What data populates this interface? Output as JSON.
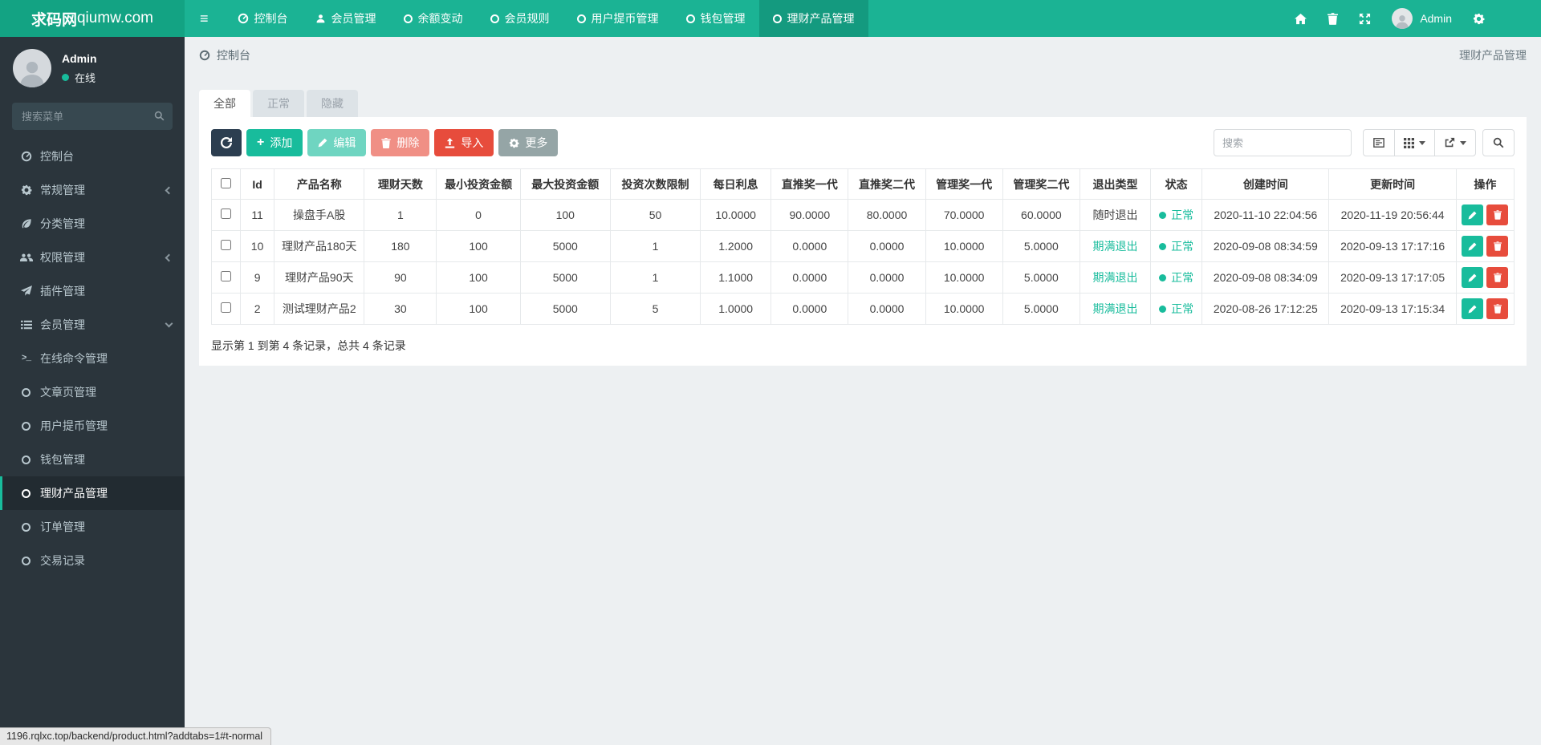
{
  "colors": {
    "navbar_teal": "#1bb394",
    "brand_teal": "#13a383",
    "navbar_active": "#149a7f",
    "sidebar_dark": "#2b353c",
    "accent_green": "#18bc9c",
    "danger_red": "#e74c3c",
    "dark_navy": "#2c3e50",
    "muted_gray": "#95a5a6",
    "page_bg": "#edf0f2"
  },
  "icons": {
    "hamburger": "≡ three bars",
    "dashboard": "gauge dial",
    "user": "person silhouette",
    "circle": "hollow ring",
    "home": "house",
    "trash": "trash can",
    "fullscreen": "four diagonal arrows",
    "cogs": "gear",
    "search": "magnifier",
    "refresh": "circular arrow",
    "plus": "+",
    "pencil": "pencil",
    "upload": "arrow up from tray",
    "list-view": "document with lines",
    "columns-grid": "3x3 squares",
    "export": "arrow out of box",
    "terminal": ">_",
    "leaf": "leaf",
    "users": "group of people",
    "send": "paper plane",
    "list": "bulleted list"
  },
  "navbar": {
    "brand_bold": "求码网",
    "brand_rest": "qiumw.com",
    "items": [
      {
        "label": "控制台",
        "icon": "dashboard-icon"
      },
      {
        "label": "会员管理",
        "icon": "user-icon"
      },
      {
        "label": "余额变动",
        "icon": "circle-icon"
      },
      {
        "label": "会员规则",
        "icon": "circle-icon"
      },
      {
        "label": "用户提币管理",
        "icon": "circle-icon"
      },
      {
        "label": "钱包管理",
        "icon": "circle-icon"
      },
      {
        "label": "理财产品管理",
        "icon": "circle-icon",
        "active": true
      }
    ],
    "user_label": "Admin"
  },
  "sidebar": {
    "profile": {
      "name": "Admin",
      "status": "在线"
    },
    "search_placeholder": "搜索菜单",
    "items": [
      {
        "label": "控制台",
        "icon": "dashboard-icon"
      },
      {
        "label": "常规管理",
        "icon": "cogs-icon",
        "chevron": "left"
      },
      {
        "label": "分类管理",
        "icon": "leaf-icon"
      },
      {
        "label": "权限管理",
        "icon": "users-icon",
        "chevron": "left"
      },
      {
        "label": "插件管理",
        "icon": "send-icon"
      },
      {
        "label": "会员管理",
        "icon": "list-icon",
        "chevron": "down"
      },
      {
        "label": "在线命令管理",
        "icon": "terminal-icon"
      },
      {
        "label": "文章页管理",
        "icon": "circle-icon"
      },
      {
        "label": "用户提币管理",
        "icon": "circle-icon"
      },
      {
        "label": "钱包管理",
        "icon": "circle-icon"
      },
      {
        "label": "理财产品管理",
        "icon": "circle-icon",
        "active": true
      },
      {
        "label": "订单管理",
        "icon": "circle-icon"
      },
      {
        "label": "交易记录",
        "icon": "circle-icon"
      }
    ]
  },
  "breadcrumb": {
    "left": "控制台",
    "right": "理财产品管理"
  },
  "tabs": [
    {
      "label": "全部",
      "active": true
    },
    {
      "label": "正常",
      "active": false
    },
    {
      "label": "隐藏",
      "active": false
    }
  ],
  "toolbar": {
    "add_label": "添加",
    "edit_label": "编辑",
    "delete_label": "删除",
    "import_label": "导入",
    "more_label": "更多",
    "search_placeholder": "搜索"
  },
  "table": {
    "columns": [
      "Id",
      "产品名称",
      "理财天数",
      "最小投资金额",
      "最大投资金额",
      "投资次数限制",
      "每日利息",
      "直推奖一代",
      "直推奖二代",
      "管理奖一代",
      "管理奖二代",
      "退出类型",
      "状态",
      "创建时间",
      "更新时间",
      "操作"
    ],
    "rows": [
      {
        "id": "11",
        "name": "操盘手A股",
        "days": "1",
        "min_invest": "0",
        "max_invest": "100",
        "times_limit": "50",
        "daily_interest": "10.0000",
        "direct1": "90.0000",
        "direct2": "80.0000",
        "manage1": "70.0000",
        "manage2": "60.0000",
        "exit_type": "随时退出",
        "exit_variant": "dark",
        "status": "正常",
        "created": "2020-11-10 22:04:56",
        "updated": "2020-11-19 20:56:44"
      },
      {
        "id": "10",
        "name": "理财产品180天",
        "days": "180",
        "min_invest": "100",
        "max_invest": "5000",
        "times_limit": "1",
        "daily_interest": "1.2000",
        "direct1": "0.0000",
        "direct2": "0.0000",
        "manage1": "10.0000",
        "manage2": "5.0000",
        "exit_type": "期满退出",
        "exit_variant": "green",
        "status": "正常",
        "created": "2020-09-08 08:34:59",
        "updated": "2020-09-13 17:17:16"
      },
      {
        "id": "9",
        "name": "理财产品90天",
        "days": "90",
        "min_invest": "100",
        "max_invest": "5000",
        "times_limit": "1",
        "daily_interest": "1.1000",
        "direct1": "0.0000",
        "direct2": "0.0000",
        "manage1": "10.0000",
        "manage2": "5.0000",
        "exit_type": "期满退出",
        "exit_variant": "green",
        "status": "正常",
        "created": "2020-09-08 08:34:09",
        "updated": "2020-09-13 17:17:05"
      },
      {
        "id": "2",
        "name": "测试理财产品2",
        "days": "30",
        "min_invest": "100",
        "max_invest": "5000",
        "times_limit": "5",
        "daily_interest": "1.0000",
        "direct1": "0.0000",
        "direct2": "0.0000",
        "manage1": "10.0000",
        "manage2": "5.0000",
        "exit_type": "期满退出",
        "exit_variant": "green",
        "status": "正常",
        "created": "2020-08-26 17:12:25",
        "updated": "2020-09-13 17:15:34"
      }
    ],
    "summary": "显示第 1 到第 4 条记录，总共 4 条记录"
  },
  "statusbar": {
    "text": "1196.rqlxc.top/backend/product.html?addtabs=1#t-normal"
  }
}
